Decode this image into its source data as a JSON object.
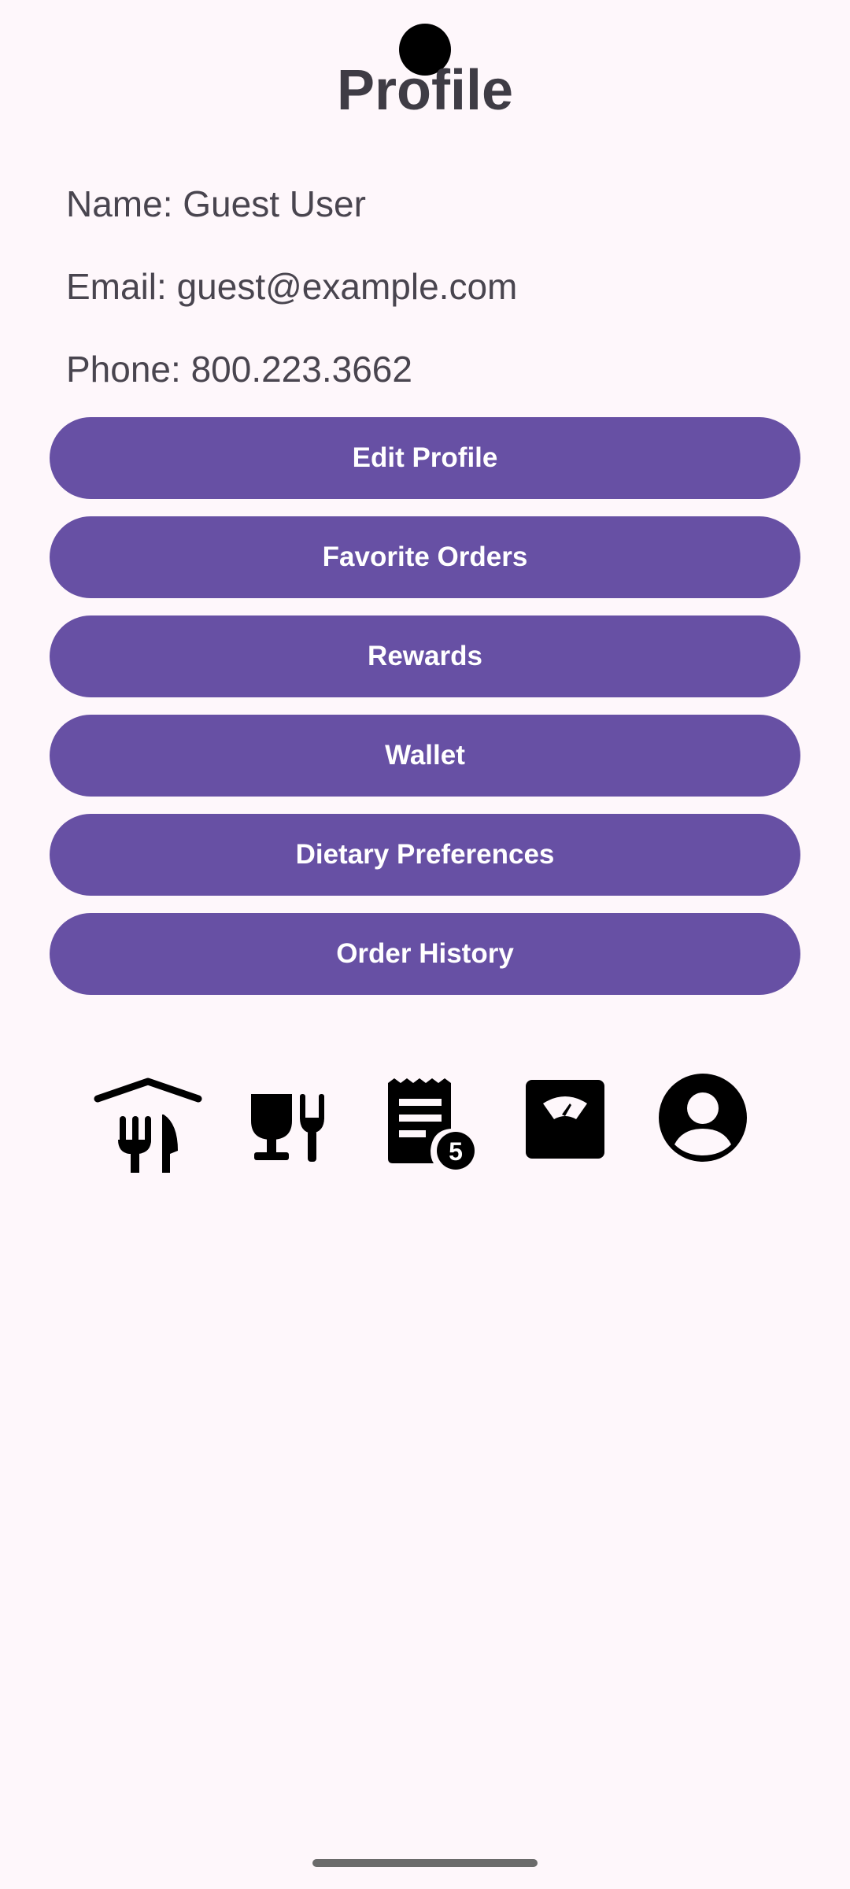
{
  "header": {
    "title": "Profile"
  },
  "profile": {
    "name": "Name: Guest User",
    "email": "Email: guest@example.com",
    "phone": "Phone: 800.223.3662"
  },
  "actions": {
    "edit_profile": "Edit Profile",
    "favorite_orders": "Favorite Orders",
    "rewards": "Rewards",
    "wallet": "Wallet",
    "dietary_preferences": "Dietary Preferences",
    "order_history": "Order History"
  },
  "bottom_nav": {
    "items": [
      {
        "icon": "restaurant-home-icon"
      },
      {
        "icon": "dining-icon"
      },
      {
        "icon": "receipt-icon",
        "badge": "5"
      },
      {
        "icon": "scale-icon"
      },
      {
        "icon": "account-circle-icon"
      }
    ]
  },
  "colors": {
    "background": "#fef7fb",
    "button": "#6750a4",
    "button_text": "#ffffff",
    "text": "#49454f"
  }
}
